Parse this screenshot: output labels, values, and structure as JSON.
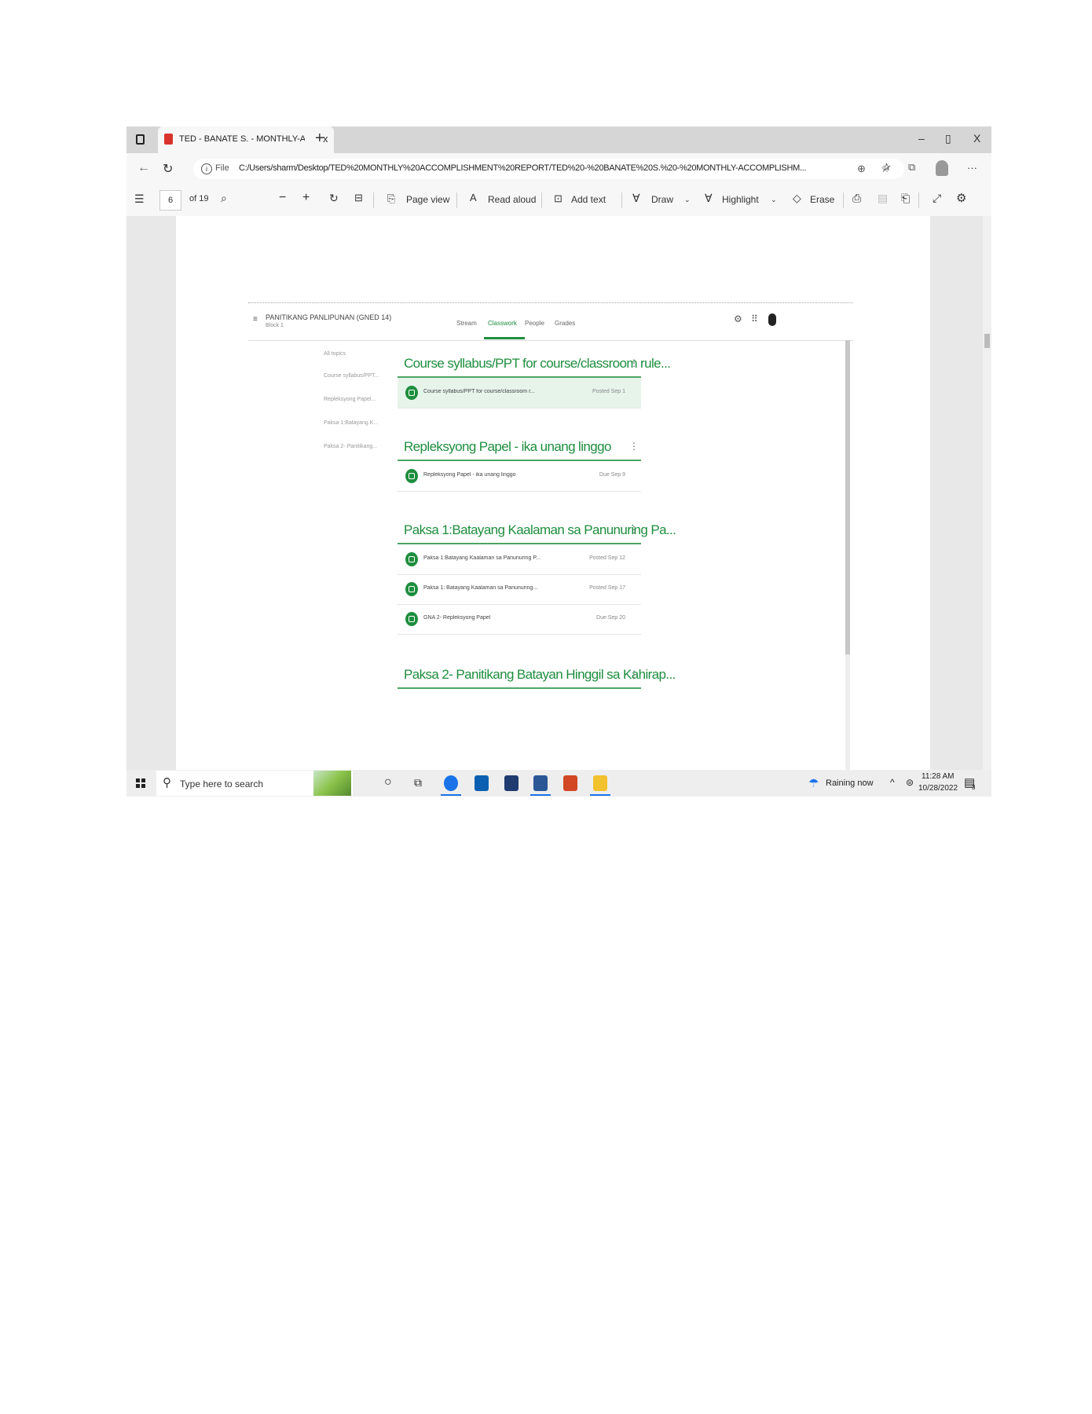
{
  "browser": {
    "tab_title": "TED - BANATE S. - MONTHLY-AC",
    "tab_close": "x",
    "new_tab": "+",
    "minimize": "–",
    "restore": "▯",
    "close": "X",
    "file_label": "File",
    "url": "C:/Users/sharm/Desktop/TED%20MONTHLY%20ACCOMPLISHMENT%20REPORT/TED%20-%20BANATE%20S.%20-%20MONTHLY-ACCOMPLISHM..."
  },
  "pdf_toolbar": {
    "page_current": "6",
    "page_total": "of 19",
    "page_view": "Page view",
    "read_aloud": "Read aloud",
    "add_text": "Add text",
    "draw": "Draw",
    "highlight": "Highlight",
    "erase": "Erase"
  },
  "classroom": {
    "class_name": "PANITIKANG PANLIPUNAN (GNED 14)",
    "section": "Block 1",
    "tabs": [
      "Stream",
      "Classwork",
      "People",
      "Grades"
    ],
    "topic_nav": [
      "All topics",
      "Course syllabus/PPT...",
      "Repleksyong Papel...",
      "Paksa 1:Batayang K...",
      "Paksa 2- Panitikang..."
    ],
    "topics": [
      {
        "title": "Course syllabus/PPT for course/classroom rule...",
        "items": [
          {
            "title": "Course syllabus/PPT for course/classroom r...",
            "date": "Posted Sep 1"
          }
        ]
      },
      {
        "title": "Repleksyong Papel - ika unang linggo",
        "items": [
          {
            "title": "Repleksyong Papel - ika unang linggo",
            "date": "Due Sep 9"
          }
        ]
      },
      {
        "title": "Paksa 1:Batayang Kaalaman sa Panunuring Pa...",
        "items": [
          {
            "title": "Paksa 1:Batayang Kaalaman sa Panunuring P...",
            "date": "Posted Sep 12"
          },
          {
            "title": "Paksa 1: Batayang Kaalaman sa Panunuring...",
            "date": "Posted Sep 17"
          },
          {
            "title": "GNA 2- Repleksyong Papel",
            "date": "Due Sep 20"
          }
        ]
      },
      {
        "title": "Paksa 2- Panitikang Batayan Hinggil sa Kahirap..."
      }
    ]
  },
  "taskbar": {
    "search_placeholder": "Type here to search",
    "weather": "Raining now",
    "time": "11:28 AM",
    "date": "10/28/2022",
    "notification_count": "3"
  },
  "colors": {
    "accent": "#1e8e3e",
    "pdf_red": "#d9342b",
    "taskbar_blue": "#1a73e8"
  }
}
